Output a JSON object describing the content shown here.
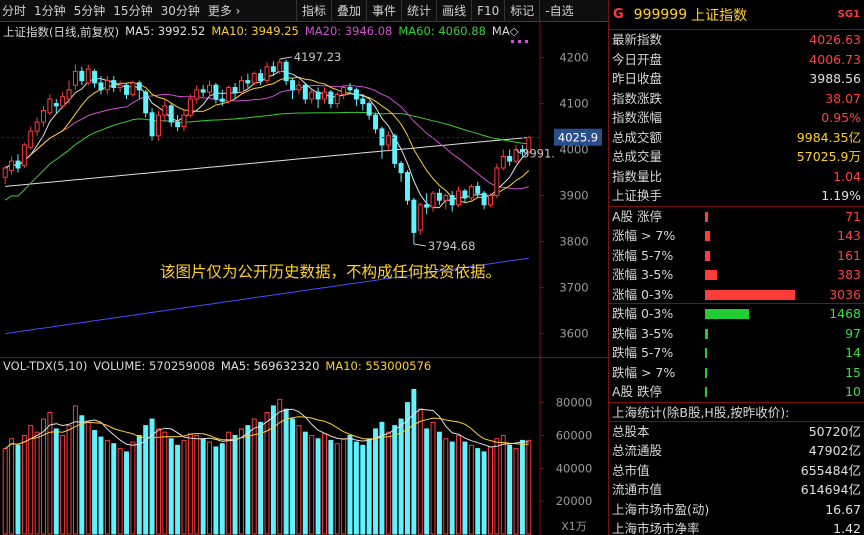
{
  "toolbar": {
    "periods": [
      "分时",
      "1分钟",
      "5分钟",
      "15分钟",
      "30分钟",
      "更多 ›"
    ],
    "tools": [
      "指标",
      "叠加",
      "事件",
      "统计",
      "画线",
      "F10",
      "标记",
      "-自选"
    ]
  },
  "kline_legend": {
    "title": "上证指数(日线,前复权)",
    "ma5_label": "MA5: 3992.52",
    "ma10_label": "MA10: 3949.25",
    "ma20_label": "MA20: 3946.08",
    "ma60_label": "MA60: 4060.88",
    "ma_icon_label": "MA◇"
  },
  "price_axis": {
    "ticks": [
      "4200",
      "4100",
      "4000",
      "3900",
      "3800",
      "3700",
      "3600"
    ],
    "current_price": "4025.9"
  },
  "annotations": {
    "high": "4197.23",
    "low": "3794.68",
    "last": "3991.",
    "disclaimer": "该图片仅为公开历史数据，不构成任何投资依据。"
  },
  "volume_legend": {
    "title": "VOL-TDX(5,10)",
    "volume_label": "VOLUME: 570259008",
    "ma5_label": "MA5: 569632320",
    "ma10_label": "MA10: 553000576"
  },
  "volume_axis": {
    "ticks": [
      "80000",
      "60000",
      "40000",
      "20000"
    ],
    "unit": "X1万"
  },
  "colors": {
    "up": "#ff3b3b",
    "down": "#5ff2ff",
    "ma5": "#e0e0e0",
    "ma10": "#ffd02a",
    "ma20": "#d24ed2",
    "ma60": "#33d233",
    "ma_long": "#e0e0e0",
    "ma_long2": "#4050ff"
  },
  "chart_data": {
    "type": "candlestick",
    "title": "上证指数(日线,前复权)",
    "ylim": [
      3560,
      4260
    ],
    "high_label": 4197.23,
    "low_label": 3794.68,
    "candles": [
      [
        3940,
        3960,
        3925,
        3965
      ],
      [
        3955,
        3975,
        3945,
        3985
      ],
      [
        3975,
        3960,
        3950,
        3990
      ],
      [
        3965,
        4010,
        3960,
        4015
      ],
      [
        4005,
        4040,
        4000,
        4050
      ],
      [
        4040,
        4060,
        4030,
        4070
      ],
      [
        4060,
        4085,
        4050,
        4095
      ],
      [
        4080,
        4110,
        4075,
        4120
      ],
      [
        4100,
        4095,
        4080,
        4110
      ],
      [
        4095,
        4115,
        4090,
        4125
      ],
      [
        4110,
        4130,
        4100,
        4150
      ],
      [
        4140,
        4170,
        4130,
        4185
      ],
      [
        4170,
        4150,
        4140,
        4180
      ],
      [
        4145,
        4175,
        4140,
        4185
      ],
      [
        4170,
        4145,
        4135,
        4175
      ],
      [
        4145,
        4130,
        4120,
        4160
      ],
      [
        4130,
        4150,
        4120,
        4160
      ],
      [
        4150,
        4135,
        4125,
        4160
      ],
      [
        4135,
        4140,
        4125,
        4150
      ],
      [
        4140,
        4120,
        4110,
        4145
      ],
      [
        4120,
        4145,
        4115,
        4150
      ],
      [
        4145,
        4130,
        4110,
        4150
      ],
      [
        4125,
        4080,
        4070,
        4130
      ],
      [
        4080,
        4030,
        4020,
        4090
      ],
      [
        4030,
        4075,
        4020,
        4085
      ],
      [
        4075,
        4095,
        4060,
        4110
      ],
      [
        4095,
        4060,
        4050,
        4100
      ],
      [
        4060,
        4050,
        4040,
        4075
      ],
      [
        4050,
        4075,
        4040,
        4085
      ],
      [
        4075,
        4110,
        4070,
        4120
      ],
      [
        4110,
        4130,
        4100,
        4140
      ],
      [
        4130,
        4125,
        4115,
        4140
      ],
      [
        4125,
        4140,
        4115,
        4150
      ],
      [
        4140,
        4110,
        4100,
        4145
      ],
      [
        4110,
        4105,
        4095,
        4130
      ],
      [
        4105,
        4135,
        4100,
        4140
      ],
      [
        4135,
        4125,
        4110,
        4145
      ],
      [
        4125,
        4150,
        4120,
        4160
      ],
      [
        4150,
        4145,
        4135,
        4165
      ],
      [
        4145,
        4165,
        4140,
        4170
      ],
      [
        4165,
        4150,
        4140,
        4175
      ],
      [
        4150,
        4180,
        4145,
        4190
      ],
      [
        4180,
        4170,
        4160,
        4192
      ],
      [
        4170,
        4190,
        4165,
        4197
      ],
      [
        4190,
        4150,
        4140,
        4195
      ],
      [
        4150,
        4130,
        4110,
        4155
      ],
      [
        4130,
        4140,
        4120,
        4150
      ],
      [
        4140,
        4110,
        4100,
        4145
      ],
      [
        4110,
        4125,
        4100,
        4130
      ],
      [
        4125,
        4110,
        4090,
        4135
      ],
      [
        4110,
        4125,
        4100,
        4135
      ],
      [
        4125,
        4100,
        4090,
        4130
      ],
      [
        4100,
        4120,
        4090,
        4125
      ],
      [
        4120,
        4135,
        4110,
        4140
      ],
      [
        4135,
        4130,
        4120,
        4145
      ],
      [
        4130,
        4110,
        4095,
        4135
      ],
      [
        4110,
        4100,
        4085,
        4120
      ],
      [
        4100,
        4075,
        4065,
        4105
      ],
      [
        4075,
        4045,
        4035,
        4080
      ],
      [
        4045,
        4010,
        3980,
        4050
      ],
      [
        4010,
        4030,
        3995,
        4040
      ],
      [
        4030,
        3970,
        3960,
        4035
      ],
      [
        3970,
        3950,
        3930,
        3975
      ],
      [
        3950,
        3890,
        3880,
        3955
      ],
      [
        3890,
        3820,
        3794.68,
        3895
      ],
      [
        3825,
        3880,
        3815,
        3885
      ],
      [
        3880,
        3875,
        3860,
        3905
      ],
      [
        3875,
        3905,
        3865,
        3910
      ],
      [
        3905,
        3890,
        3880,
        3915
      ],
      [
        3890,
        3900,
        3870,
        3905
      ],
      [
        3900,
        3880,
        3865,
        3910
      ],
      [
        3880,
        3910,
        3875,
        3920
      ],
      [
        3910,
        3895,
        3885,
        3915
      ],
      [
        3895,
        3920,
        3890,
        3925
      ],
      [
        3920,
        3905,
        3895,
        3930
      ],
      [
        3905,
        3880,
        3870,
        3910
      ],
      [
        3880,
        3900,
        3875,
        3905
      ],
      [
        3900,
        3960,
        3895,
        3970
      ],
      [
        3960,
        3985,
        3955,
        4000
      ],
      [
        3985,
        3975,
        3965,
        4000
      ],
      [
        3975,
        4000,
        3970,
        4010
      ],
      [
        4000,
        3995,
        3985,
        4010
      ],
      [
        3995,
        4026,
        3990,
        4030
      ]
    ],
    "volume": {
      "ylim": [
        0,
        95000
      ],
      "ticks": [
        20000,
        40000,
        60000,
        80000
      ],
      "unit": "X1万",
      "values": [
        52000,
        58000,
        54000,
        60000,
        66000,
        62000,
        70000,
        74000,
        64000,
        60000,
        66000,
        78000,
        72000,
        68000,
        63000,
        59000,
        57000,
        55000,
        52000,
        50000,
        56000,
        60000,
        66000,
        70000,
        64000,
        62000,
        58000,
        54000,
        57000,
        61000,
        60000,
        58000,
        56000,
        53000,
        55000,
        62000,
        60000,
        64000,
        66000,
        70000,
        68000,
        74000,
        78000,
        82000,
        76000,
        70000,
        66000,
        62000,
        60000,
        58000,
        61000,
        57000,
        55000,
        58000,
        60000,
        56000,
        54000,
        58000,
        64000,
        68000,
        62000,
        66000,
        70000,
        80000,
        88000,
        76000,
        64000,
        68000,
        62000,
        58000,
        56000,
        60000,
        56000,
        54000,
        52000,
        50000,
        53000,
        58000,
        60000,
        54000,
        52000,
        57000,
        57026
      ]
    }
  },
  "panel": {
    "header": {
      "g": "G",
      "code": "999999",
      "name": "上证指数",
      "sg": "SG1"
    },
    "quote": [
      {
        "label": "最新指数",
        "value": "4026.63",
        "cls": "red"
      },
      {
        "label": "今日开盘",
        "value": "4006.73",
        "cls": "red"
      },
      {
        "label": "昨日收盘",
        "value": "3988.56",
        "cls": "wht"
      },
      {
        "label": "指数涨跌",
        "value": "38.07",
        "cls": "red"
      },
      {
        "label": "指数涨幅",
        "value": "0.95%",
        "cls": "red"
      },
      {
        "label": "总成交额",
        "value": "9984.35亿",
        "cls": "yel"
      },
      {
        "label": "总成交量",
        "value": "57025.9万",
        "cls": "yel"
      },
      {
        "label": "指数量比",
        "value": "1.04",
        "cls": "red"
      },
      {
        "label": "上证换手",
        "value": "1.19%",
        "cls": "wht"
      }
    ],
    "breadth": [
      {
        "label": "A股 涨停",
        "value": "71",
        "cls": "red",
        "bar": 3,
        "color": "#ff3b3b"
      },
      {
        "label": "涨幅 > 7%",
        "value": "143",
        "cls": "red",
        "bar": 5,
        "color": "#ff3b3b"
      },
      {
        "label": "涨幅 5-7%",
        "value": "161",
        "cls": "red",
        "bar": 5,
        "color": "#ff3b3b"
      },
      {
        "label": "涨幅 3-5%",
        "value": "383",
        "cls": "red",
        "bar": 12,
        "color": "#ff3b3b"
      },
      {
        "label": "涨幅 0-3%",
        "value": "3036",
        "cls": "red",
        "bar": 90,
        "color": "#ff3b3b"
      },
      {
        "label": "跌幅 0-3%",
        "value": "1468",
        "cls": "grn",
        "bar": 44,
        "color": "#22cc33"
      },
      {
        "label": "跌幅 3-5%",
        "value": "97",
        "cls": "grn",
        "bar": 3,
        "color": "#22cc33"
      },
      {
        "label": "跌幅 5-7%",
        "value": "14",
        "cls": "grn",
        "bar": 1,
        "color": "#22cc33"
      },
      {
        "label": "跌幅 > 7%",
        "value": "15",
        "cls": "grn",
        "bar": 1,
        "color": "#22cc33"
      },
      {
        "label": "A股 跌停",
        "value": "10",
        "cls": "grn",
        "bar": 1,
        "color": "#22cc33"
      }
    ],
    "stats_title": "上海统计(除B股,H股,按昨收价):",
    "stats": [
      {
        "label": "总股本",
        "value": "50720亿",
        "cls": "wht"
      },
      {
        "label": "总流通股",
        "value": "47902亿",
        "cls": "wht"
      },
      {
        "label": "总市值",
        "value": "655484亿",
        "cls": "wht"
      },
      {
        "label": "流通市值",
        "value": "614694亿",
        "cls": "wht"
      },
      {
        "label": "上海市场市盈(动)",
        "value": "16.67",
        "cls": "wht"
      },
      {
        "label": "上海市场市净率",
        "value": "1.42",
        "cls": "wht"
      }
    ]
  }
}
